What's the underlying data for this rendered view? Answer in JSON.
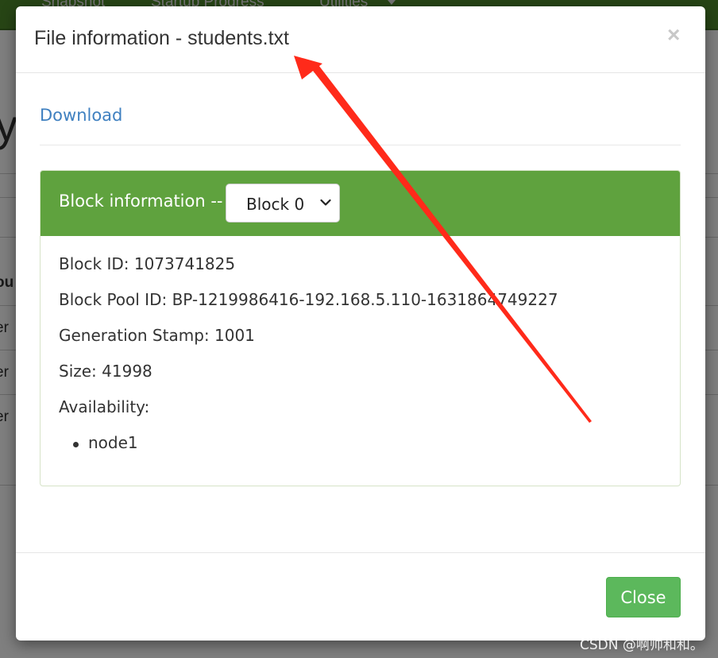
{
  "background": {
    "nav_items": [
      "s",
      "Snapshot",
      "Startup Progress",
      "Utilities"
    ],
    "big_letter": "y",
    "column_header": "ou",
    "cell_fragments": [
      "er",
      "er",
      "er"
    ]
  },
  "modal": {
    "title": "File information - students.txt",
    "close_icon_glyph": "×",
    "download_label": "Download",
    "panel": {
      "title": "Block information --",
      "select_value": "Block 0",
      "fields": [
        "Block ID: 1073741825",
        "Block Pool ID: BP-1219986416-192.168.5.110-1631864749227",
        "Generation Stamp: 1001",
        "Size: 41998",
        "Availability:"
      ],
      "nodes": [
        "node1"
      ]
    },
    "close_button_label": "Close"
  },
  "annotation": {
    "arrow_color": "#ff2a1a"
  },
  "watermark": "CSDN @啊帅和和。",
  "colors": {
    "navbar": "#4f8a2a",
    "panel_heading": "#5fa23e",
    "link": "#3f80c0",
    "close_button": "#5cb85c"
  }
}
